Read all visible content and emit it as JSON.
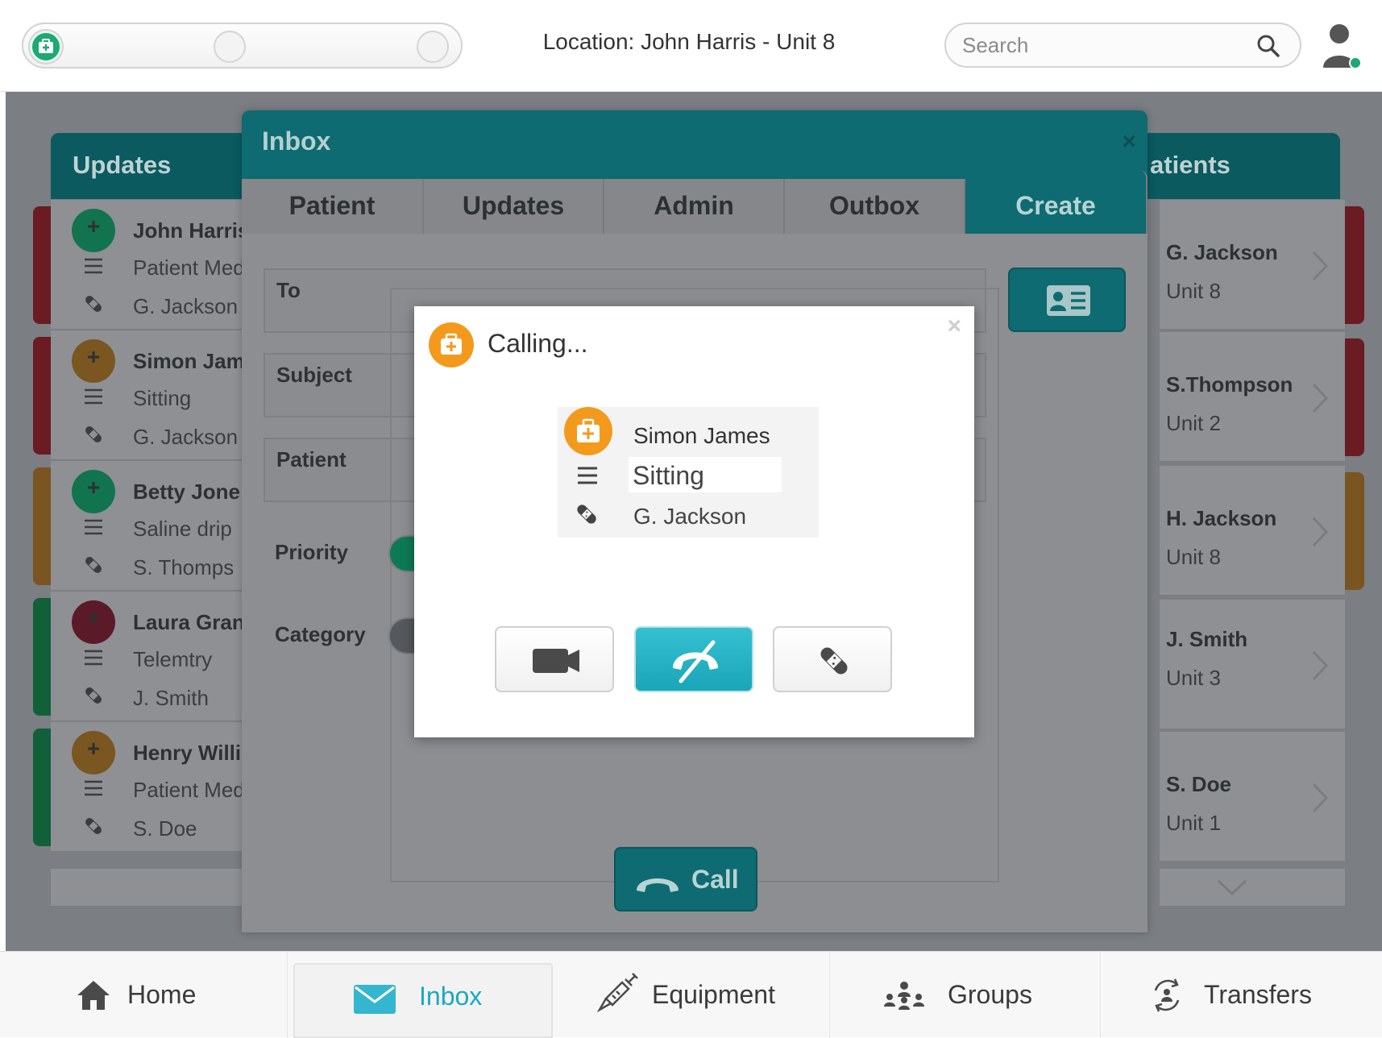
{
  "topbar": {
    "location": "Location: John Harris - Unit 8",
    "search_placeholder": "Search",
    "icons": [
      "medical-kit-icon",
      "search-icon",
      "user-icon"
    ]
  },
  "updates_panel": {
    "title": "Updates",
    "cards": [
      {
        "name": "John Harris",
        "detail": "Patient Med",
        "nurse": "G. Jackson",
        "stripe": "#6b1b22",
        "badge": "#12744f"
      },
      {
        "name": "Simon Jam",
        "detail": "Sitting",
        "nurse": "G. Jackson",
        "stripe": "#6b1b22",
        "badge": "#7a5620"
      },
      {
        "name": "Betty Jone",
        "detail": "Saline drip",
        "nurse": "S. Thomps",
        "stripe": "#7a5522",
        "badge": "#12744f"
      },
      {
        "name": "Laura Gran",
        "detail": "Telemtry",
        "nurse": "J. Smith",
        "stripe": "#12603a",
        "badge": "#5a1a28"
      },
      {
        "name": "Henry Willi",
        "detail": "Patient Med",
        "nurse": "S. Doe",
        "stripe": "#12603a",
        "badge": "#7a5620"
      }
    ]
  },
  "patients_panel": {
    "title": "atients",
    "cards": [
      {
        "name": "G. Jackson",
        "unit": "Unit 8",
        "stripe": "#6b1b22"
      },
      {
        "name": "S.Thompson",
        "unit": "Unit 2",
        "stripe": "#6b1b22"
      },
      {
        "name": "H. Jackson",
        "unit": "Unit 8",
        "stripe": "#7a5522"
      },
      {
        "name": "J. Smith",
        "unit": "Unit 3",
        "stripe": null
      },
      {
        "name": "S. Doe",
        "unit": "Unit 1",
        "stripe": null
      }
    ]
  },
  "inbox": {
    "title": "Inbox",
    "close": "×",
    "tabs": [
      "Patient",
      "Updates",
      "Admin",
      "Outbox",
      "Create"
    ],
    "active_tab": "Create",
    "fields": {
      "to": "To",
      "subject": "Subject",
      "patient": "Patient"
    },
    "priority_label": "Priority",
    "category_label": "Category",
    "call_button": "Call"
  },
  "calling_dialog": {
    "title": "Calling...",
    "close": "×",
    "patient_name": "Simon James",
    "condition": "Sitting",
    "nurse": "G. Jackson",
    "buttons": [
      "video-call",
      "hang-up",
      "nurse-transfer"
    ]
  },
  "bottom_nav": {
    "items": [
      {
        "label": "Home",
        "icon": "home-icon"
      },
      {
        "label": "Inbox",
        "icon": "mail-icon",
        "active": true
      },
      {
        "label": "Equipment",
        "icon": "syringe-icon"
      },
      {
        "label": "Groups",
        "icon": "groups-icon"
      },
      {
        "label": "Transfers",
        "icon": "transfers-icon"
      }
    ]
  },
  "colors": {
    "accent_teal": "#0d6b71",
    "accent_cyan": "#1ba8c0",
    "calling_orange": "#f39a1c",
    "status_green": "#1ba974"
  }
}
